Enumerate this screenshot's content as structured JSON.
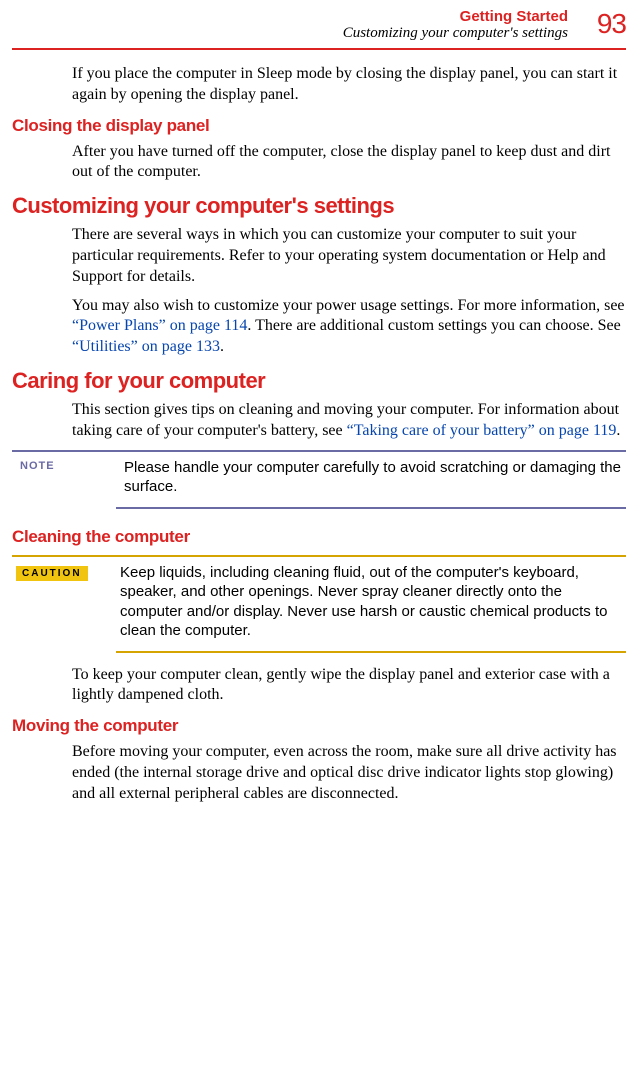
{
  "header": {
    "chapter": "Getting Started",
    "subtitle": "Customizing your computer's settings",
    "page_number": "93"
  },
  "intro_para": "If you place the computer in Sleep mode by closing the display panel, you can start it again by opening the display panel.",
  "closing_panel": {
    "heading": "Closing the display panel",
    "body": "After you have turned off the computer, close the display panel to keep dust and dirt out of the computer."
  },
  "customizing": {
    "heading": "Customizing your computer's settings",
    "p1": "There are several ways in which you can customize your computer to suit your particular requirements. Refer to your operating system documentation or Help and Support for details.",
    "p2_a": "You may also wish to customize your power usage settings. For more information, see ",
    "p2_link1": "“Power Plans” on page 114",
    "p2_b": ". There are additional custom settings you can choose. See ",
    "p2_link2": "“Utilities” on page 133",
    "p2_c": "."
  },
  "caring": {
    "heading": "Caring for your computer",
    "p1_a": "This section gives tips on cleaning and moving your computer. For information about taking care of your computer's battery, see ",
    "p1_link": "“Taking care of your battery” on page 119",
    "p1_b": "."
  },
  "note": {
    "label": "NOTE",
    "text": "Please handle your computer carefully to avoid scratching or damaging the surface."
  },
  "cleaning": {
    "heading": "Cleaning the computer",
    "caution_label": "CAUTION",
    "caution_text": "Keep liquids, including cleaning fluid, out of the computer's keyboard, speaker, and other openings. Never spray cleaner directly onto the computer and/or display. Never use harsh or caustic chemical products to clean the computer.",
    "body": "To keep your computer clean, gently wipe the display panel and exterior case with a lightly dampened cloth."
  },
  "moving": {
    "heading": "Moving the computer",
    "body": "Before moving your computer, even across the room, make sure all drive activity has ended (the internal storage drive and optical disc drive indicator lights stop glowing) and all external peripheral cables are disconnected."
  }
}
